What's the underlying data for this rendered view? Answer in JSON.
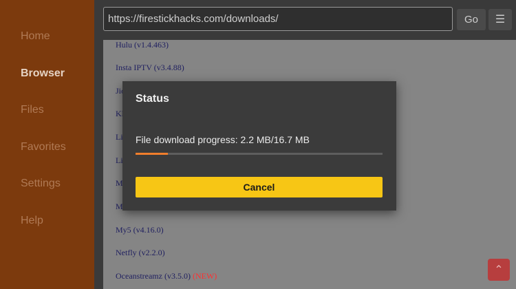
{
  "sidebar": {
    "items": [
      {
        "label": "Home"
      },
      {
        "label": "Browser",
        "active": true
      },
      {
        "label": "Files"
      },
      {
        "label": "Favorites"
      },
      {
        "label": "Settings"
      },
      {
        "label": "Help"
      }
    ]
  },
  "toolbar": {
    "url": "https://firestickhacks.com/downloads/",
    "go_label": "Go",
    "menu_icon": "hamburger-icon"
  },
  "page": {
    "links": [
      {
        "text": "Hulu (v1.4.463)"
      },
      {
        "text": "Insta IPTV (v3.4.88)"
      },
      {
        "text": "Jio"
      },
      {
        "text": "Kl"
      },
      {
        "text": "Li"
      },
      {
        "text": "Li"
      },
      {
        "text": "M"
      },
      {
        "text": "M"
      },
      {
        "text": "My5 (v4.16.0)"
      },
      {
        "text": "Netfly (v2.2.0)"
      },
      {
        "text": "Oceanstreamz (v3.5.0)",
        "badge": "(NEW)"
      }
    ]
  },
  "dialog": {
    "title": "Status",
    "message": "File download progress: 2.2 MB/16.7 MB",
    "progress": 0.1317,
    "cancel_label": "Cancel"
  },
  "colors": {
    "sidebar": "#7c3a0d",
    "accent_button": "#f7c615",
    "progress_fill": "#f07e2c",
    "new_badge": "#ff3030"
  },
  "fab_icon": "chevron-up-icon"
}
